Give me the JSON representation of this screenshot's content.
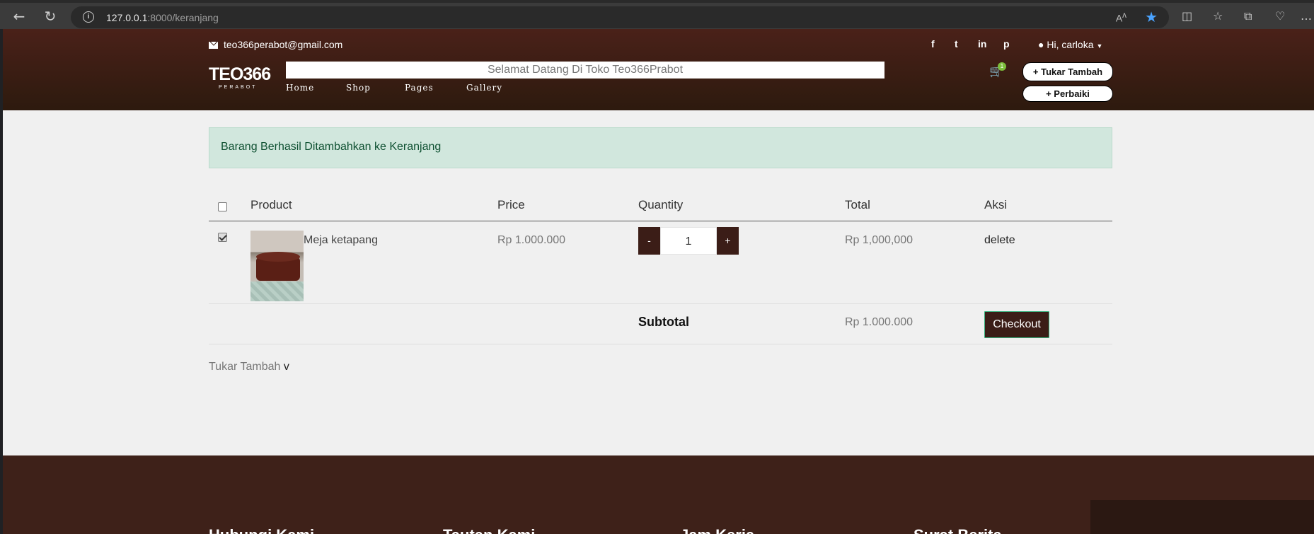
{
  "browser": {
    "url_host": "127.0.0.1",
    "url_rest": ":8000/keranjang",
    "icons": [
      "back-icon",
      "reload-icon",
      "info-icon",
      "read-aloud-icon",
      "favorite-star-icon",
      "split-screen-icon",
      "favorites-icon",
      "collections-icon",
      "health-icon",
      "more-icon"
    ]
  },
  "header": {
    "email": "teo366perabot@gmail.com",
    "social": [
      "f",
      "t",
      "in",
      "p"
    ],
    "user_greeting": "Hi, carloka",
    "logo_main": "TEO366",
    "logo_sub": "PERABOT",
    "welcome": "Selamat Datang Di Toko Teo366Prabot",
    "menu": [
      "Home",
      "Shop",
      "Pages",
      "Gallery"
    ],
    "cart_count": "1",
    "btn_tukar": "+ Tukar Tambah",
    "btn_perbaiki": "+ Perbaiki"
  },
  "alert": "Barang Berhasil Ditambahkan ke Keranjang",
  "table": {
    "headers": {
      "product": "Product",
      "price": "Price",
      "quantity": "Quantity",
      "total": "Total",
      "aksi": "Aksi"
    },
    "rows": [
      {
        "checked": true,
        "product": "Meja ketapang",
        "price": "Rp 1.000.000",
        "qty": "1",
        "minus": "-",
        "plus": "+",
        "total": "Rp 1,000,000",
        "action": "delete"
      }
    ],
    "subtotal_label": "Subtotal",
    "subtotal_value": "Rp 1.000.000",
    "checkout": "Checkout"
  },
  "tukar_tambah": "Tukar Tambah",
  "tukar_caret": "v",
  "footer": {
    "headings": [
      "Hubungi Kami",
      "Tautan Kami",
      "Jam Kerja",
      "Surat Berita"
    ]
  }
}
